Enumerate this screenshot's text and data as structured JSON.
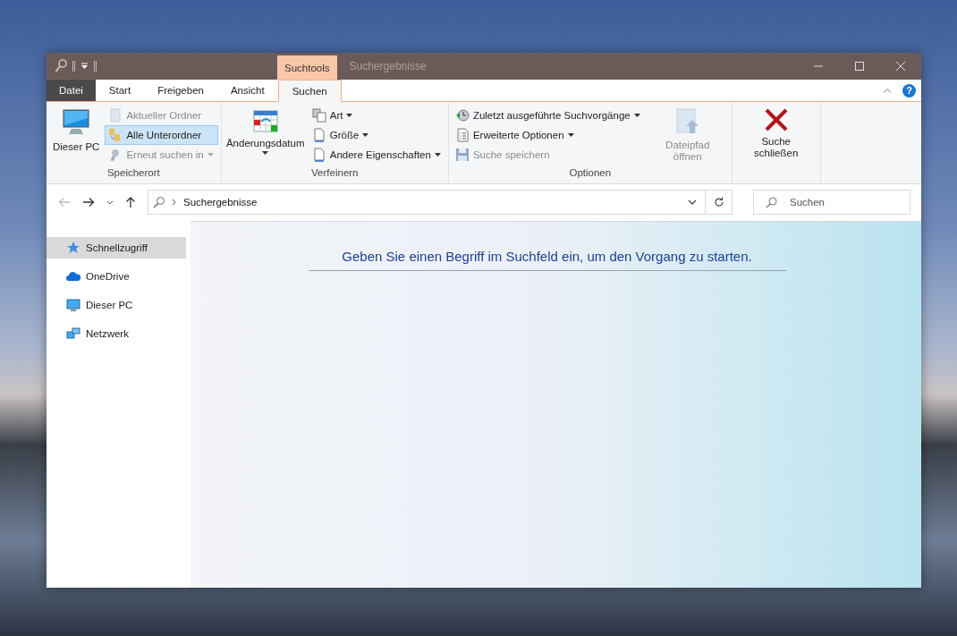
{
  "title_bar": {
    "context_tab": "Suchtools",
    "title": "Suchergebnisse"
  },
  "ribbon_tabs": [
    {
      "label": "Datei",
      "kind": "file",
      "selected": false
    },
    {
      "label": "Start",
      "kind": "tab",
      "selected": false
    },
    {
      "label": "Freigeben",
      "kind": "tab",
      "selected": false
    },
    {
      "label": "Ansicht",
      "kind": "tab",
      "selected": false
    },
    {
      "label": "Suchen",
      "kind": "context",
      "selected": true
    }
  ],
  "help": "?",
  "groups": [
    {
      "label": "Speicherort",
      "items": [
        {
          "kind": "large",
          "label": "Dieser PC",
          "disabled": false,
          "dropdown": false
        },
        {
          "kind": "small",
          "label": "Aktueller Ordner",
          "disabled": true,
          "selected": false,
          "dropdown": false
        },
        {
          "kind": "small",
          "label": "Alle Unterordner",
          "disabled": false,
          "selected": true,
          "dropdown": false
        },
        {
          "kind": "small",
          "label": "Erneut suchen in",
          "disabled": true,
          "selected": false,
          "dropdown": true
        }
      ]
    },
    {
      "label": "Verfeinern",
      "items": [
        {
          "kind": "large",
          "label": "Änderungsdatum",
          "disabled": false,
          "dropdown": true
        },
        {
          "kind": "small",
          "label": "Art",
          "disabled": false,
          "selected": false,
          "dropdown": true
        },
        {
          "kind": "small",
          "label": "Größe",
          "disabled": false,
          "selected": false,
          "dropdown": true
        },
        {
          "kind": "small",
          "label": "Andere Eigenschaften",
          "disabled": false,
          "selected": false,
          "dropdown": true
        }
      ]
    },
    {
      "label": "Optionen",
      "items": [
        {
          "kind": "small",
          "label": "Zuletzt ausgeführte Suchvorgänge",
          "disabled": false,
          "selected": false,
          "dropdown": true
        },
        {
          "kind": "small",
          "label": "Erweiterte Optionen",
          "disabled": false,
          "selected": false,
          "dropdown": true
        },
        {
          "kind": "small",
          "label": "Suche speichern",
          "disabled": true,
          "selected": false,
          "dropdown": false
        },
        {
          "kind": "large",
          "label": "Dateipfad öffnen",
          "disabled": true,
          "dropdown": false
        }
      ]
    },
    {
      "items": [
        {
          "kind": "large",
          "label": "Suche schließen",
          "disabled": false,
          "dropdown": false
        }
      ]
    }
  ],
  "address_bar": {
    "path": "Suchergebnisse",
    "back_disabled": true
  },
  "search": {
    "placeholder": "Suchen"
  },
  "sidebar": {
    "items": [
      {
        "label": "Schnellzugriff",
        "selected": true
      },
      {
        "label": "OneDrive",
        "selected": false
      },
      {
        "label": "Dieser PC",
        "selected": false
      },
      {
        "label": "Netzwerk",
        "selected": false
      }
    ]
  },
  "content": {
    "message": "Geben Sie einen Begriff im Suchfeld ein, um den Vorgang zu starten."
  }
}
